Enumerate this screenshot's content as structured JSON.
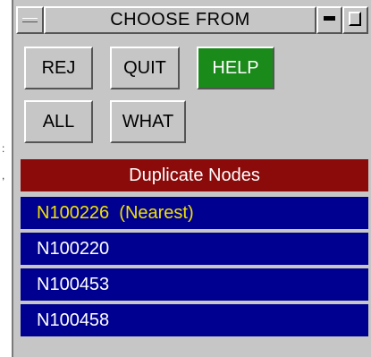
{
  "window": {
    "title": "CHOOSE FROM"
  },
  "buttons": {
    "rej": "REJ",
    "quit": "QUIT",
    "help": "HELP",
    "all": "ALL",
    "what": "WHAT"
  },
  "list": {
    "header": "Duplicate Nodes",
    "items": [
      "N100226  (Nearest)",
      "N100220",
      "N100453",
      "N100458"
    ]
  },
  "edge_marks": [
    ":",
    ","
  ],
  "colors": {
    "panel": "#c6c6c6",
    "help_button": "#1a8a1a",
    "list_header": "#8b0a0a",
    "list_item": "#000090",
    "nearest_text": "#f0e000"
  },
  "icons": [
    "window-menu-icon",
    "minimize-icon",
    "maximize-icon"
  ]
}
